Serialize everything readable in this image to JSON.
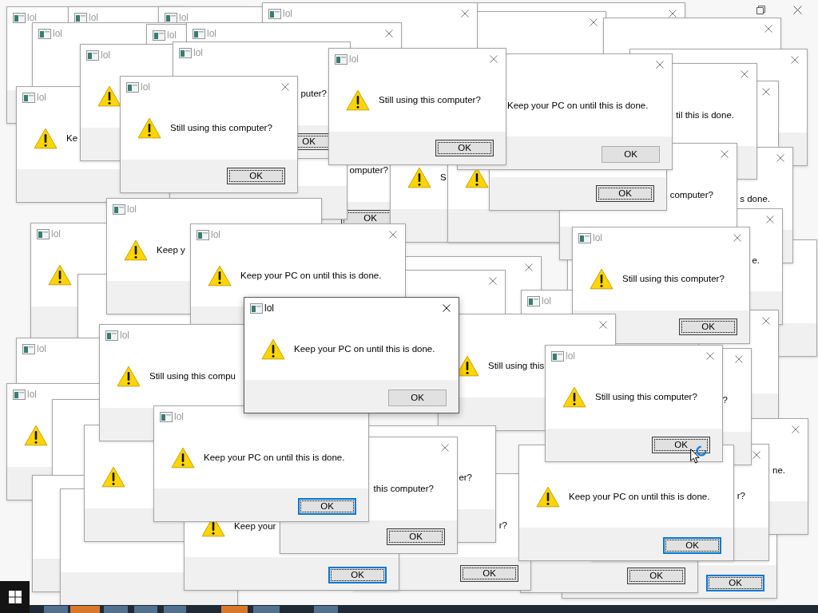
{
  "windows": [
    {
      "title": "lol",
      "active": false
    },
    {
      "title": "lol",
      "active": false
    },
    {
      "title": "lol",
      "active": false
    },
    {
      "title": "lol",
      "active": false
    },
    {
      "title": "lol",
      "active": false
    },
    {
      "title": "lol",
      "active": false
    },
    {
      "title": "lol",
      "active": false
    },
    {
      "title": "lol",
      "active": false
    },
    {
      "title": "lol",
      "active": false,
      "message": "puter?",
      "button": {
        "label": "OK",
        "kind": "focused"
      }
    },
    {
      "title": "lol",
      "active": false,
      "message": "Still using this computer?",
      "button": {
        "label": "OK",
        "kind": "focused"
      }
    },
    {
      "message": "Keep your PC on until this is done.",
      "button": {
        "label": "OK",
        "kind": "plain"
      }
    },
    {
      "title": "lol",
      "active": false,
      "message": "Ke"
    },
    {
      "title": "lol",
      "active": false,
      "message": "Still using this computer?",
      "button": {
        "label": "OK",
        "kind": "focused"
      }
    },
    {
      "message": "til this is done."
    },
    {
      "message": "omputer?",
      "button": {
        "label": "OK",
        "kind": "focused"
      }
    },
    {
      "message": "S"
    },
    {
      "message": "computer?"
    },
    {
      "message": "s done."
    },
    {
      "title": "lol",
      "active": false,
      "message": "Keep y"
    },
    {
      "button": {
        "label": "OK",
        "kind": "focused"
      }
    },
    {
      "title": "lol",
      "active": false
    },
    {
      "title": "lol",
      "active": false,
      "message": "Keep your PC on until this is done."
    },
    {
      "title": "lol",
      "active": false,
      "message": "Still using this computer?",
      "button": {
        "label": "OK",
        "kind": "focused"
      }
    },
    {
      "message": "e."
    },
    {
      "title": "lol",
      "active": false,
      "message": "Still using this compu"
    },
    {
      "title": "lol",
      "active": true,
      "message": "Keep your PC on until this is done.",
      "button": {
        "label": "OK",
        "kind": "plain"
      }
    },
    {
      "title": "lol",
      "active": false
    },
    {
      "message": "Still using this"
    },
    {
      "title": "lol",
      "active": false
    },
    {
      "title": "lol",
      "active": false,
      "message": "Still using this computer?",
      "button": {
        "label": "OK",
        "kind": "focused"
      }
    },
    {
      "message": "?"
    },
    {
      "title": "lol",
      "active": false
    },
    {
      "title": "lol",
      "active": false,
      "message": "Keep your PC on until this is done.",
      "button": {
        "label": "OK",
        "kind": "default"
      }
    },
    {
      "message": "ne."
    },
    {
      "message": "this computer?",
      "button": {
        "label": "OK",
        "kind": "focused"
      }
    },
    {
      "message": "er?"
    },
    {
      "message": "Keep your PC on until this is done.",
      "button": {
        "label": "OK",
        "kind": "default"
      }
    },
    {
      "message": "r?"
    },
    {
      "message": "Keep your",
      "button": {
        "label": "OK",
        "kind": "default"
      }
    },
    {
      "message": "r?",
      "button": {
        "label": "OK",
        "kind": "focused"
      }
    },
    {
      "button": {
        "label": "OK",
        "kind": "focused"
      }
    },
    {
      "button": {
        "label": "OK",
        "kind": "default"
      }
    }
  ]
}
